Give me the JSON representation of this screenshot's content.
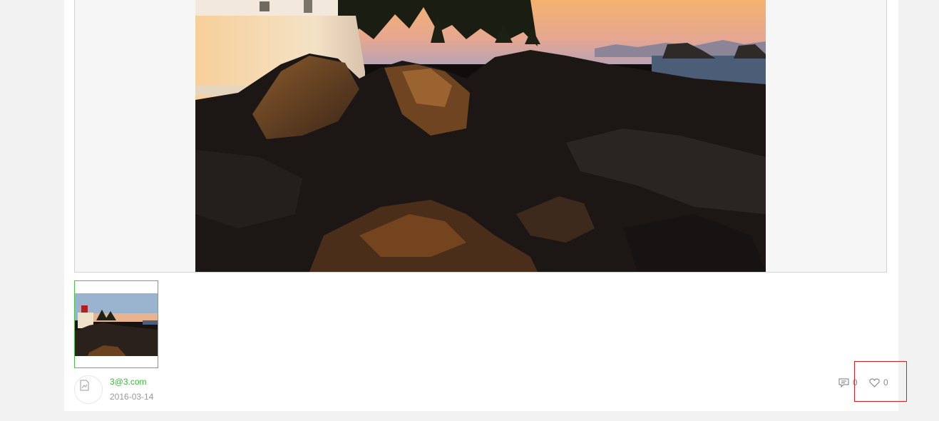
{
  "post": {
    "author": "3@3.com",
    "date": "2016-03-14",
    "comment_count": "0",
    "like_count": "0"
  },
  "images": {
    "main_alt": "lighthouse on rocky shore at sunset",
    "thumb_alt": "lighthouse thumbnail"
  },
  "icons": {
    "avatar": "broken-image-icon",
    "comment": "comment-icon",
    "like": "heart-icon"
  },
  "colors": {
    "author_link": "#3cb83c",
    "thumb_border": "#4bc34b",
    "highlight": "#d62020"
  }
}
